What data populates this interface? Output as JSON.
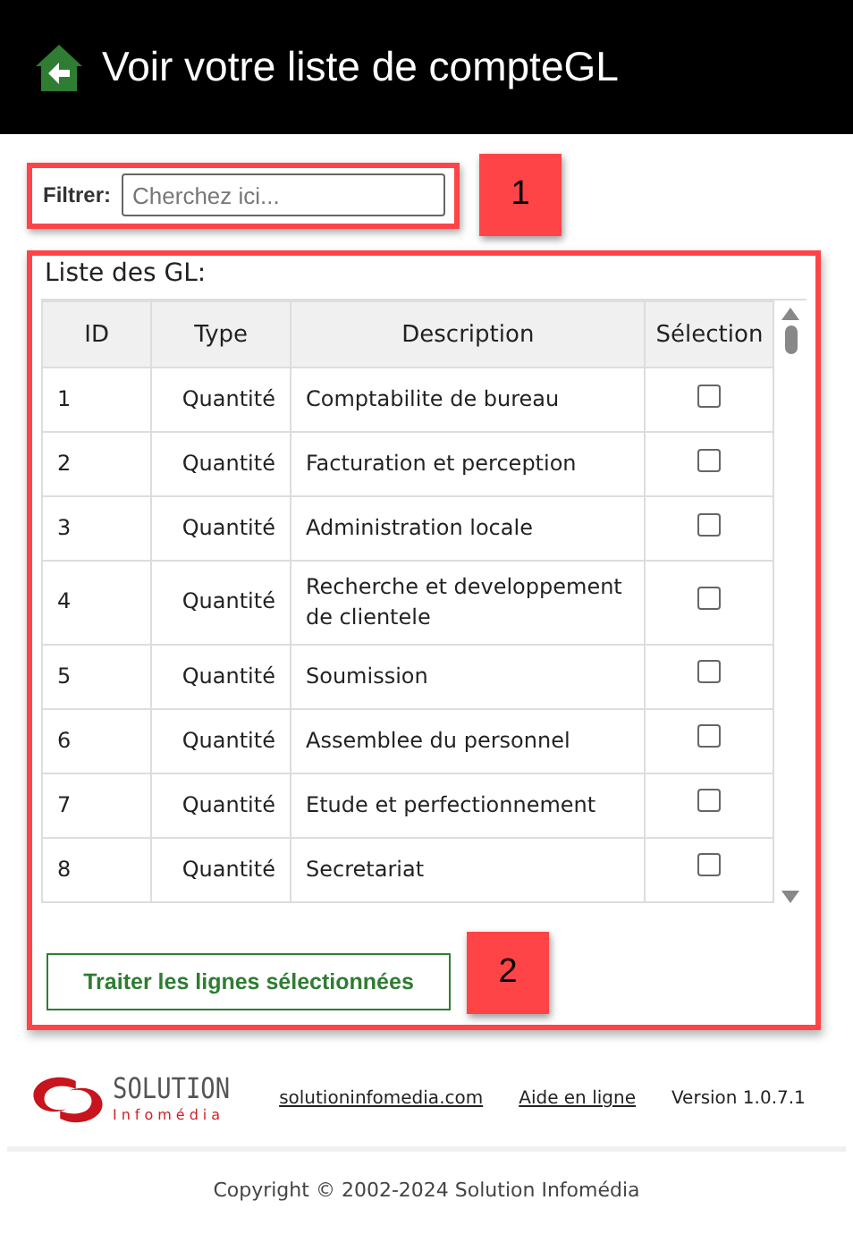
{
  "header": {
    "title": "Voir votre liste de compteGL"
  },
  "filter": {
    "label": "Filtrer:",
    "placeholder": "Cherchez ici...",
    "callout": "1"
  },
  "list": {
    "title": "Liste des GL:",
    "columns": [
      "ID",
      "Type",
      "Description",
      "Sélection"
    ],
    "rows": [
      {
        "id": "1",
        "type": "Quantité",
        "description": "Comptabilite de bureau",
        "checked": false
      },
      {
        "id": "2",
        "type": "Quantité",
        "description": "Facturation et perception",
        "checked": false
      },
      {
        "id": "3",
        "type": "Quantité",
        "description": "Administration locale",
        "checked": false
      },
      {
        "id": "4",
        "type": "Quantité",
        "description": "Recherche et developpement de clientele",
        "checked": false
      },
      {
        "id": "5",
        "type": "Quantité",
        "description": "Soumission",
        "checked": false
      },
      {
        "id": "6",
        "type": "Quantité",
        "description": "Assemblee du personnel",
        "checked": false
      },
      {
        "id": "7",
        "type": "Quantité",
        "description": "Etude et perfectionnement",
        "checked": false
      },
      {
        "id": "8",
        "type": "Quantité",
        "description": "Secretariat",
        "checked": false
      }
    ],
    "button": "Traiter les lignes sélectionnées",
    "callout": "2"
  },
  "footer": {
    "logo_name": "SOLUTION",
    "logo_sub": "Infomédia",
    "links": [
      "solutioninfomedia.com",
      "Aide en ligne"
    ],
    "version": "Version 1.0.7.1",
    "copyright": "Copyright © 2002-2024 Solution Infomédia"
  }
}
